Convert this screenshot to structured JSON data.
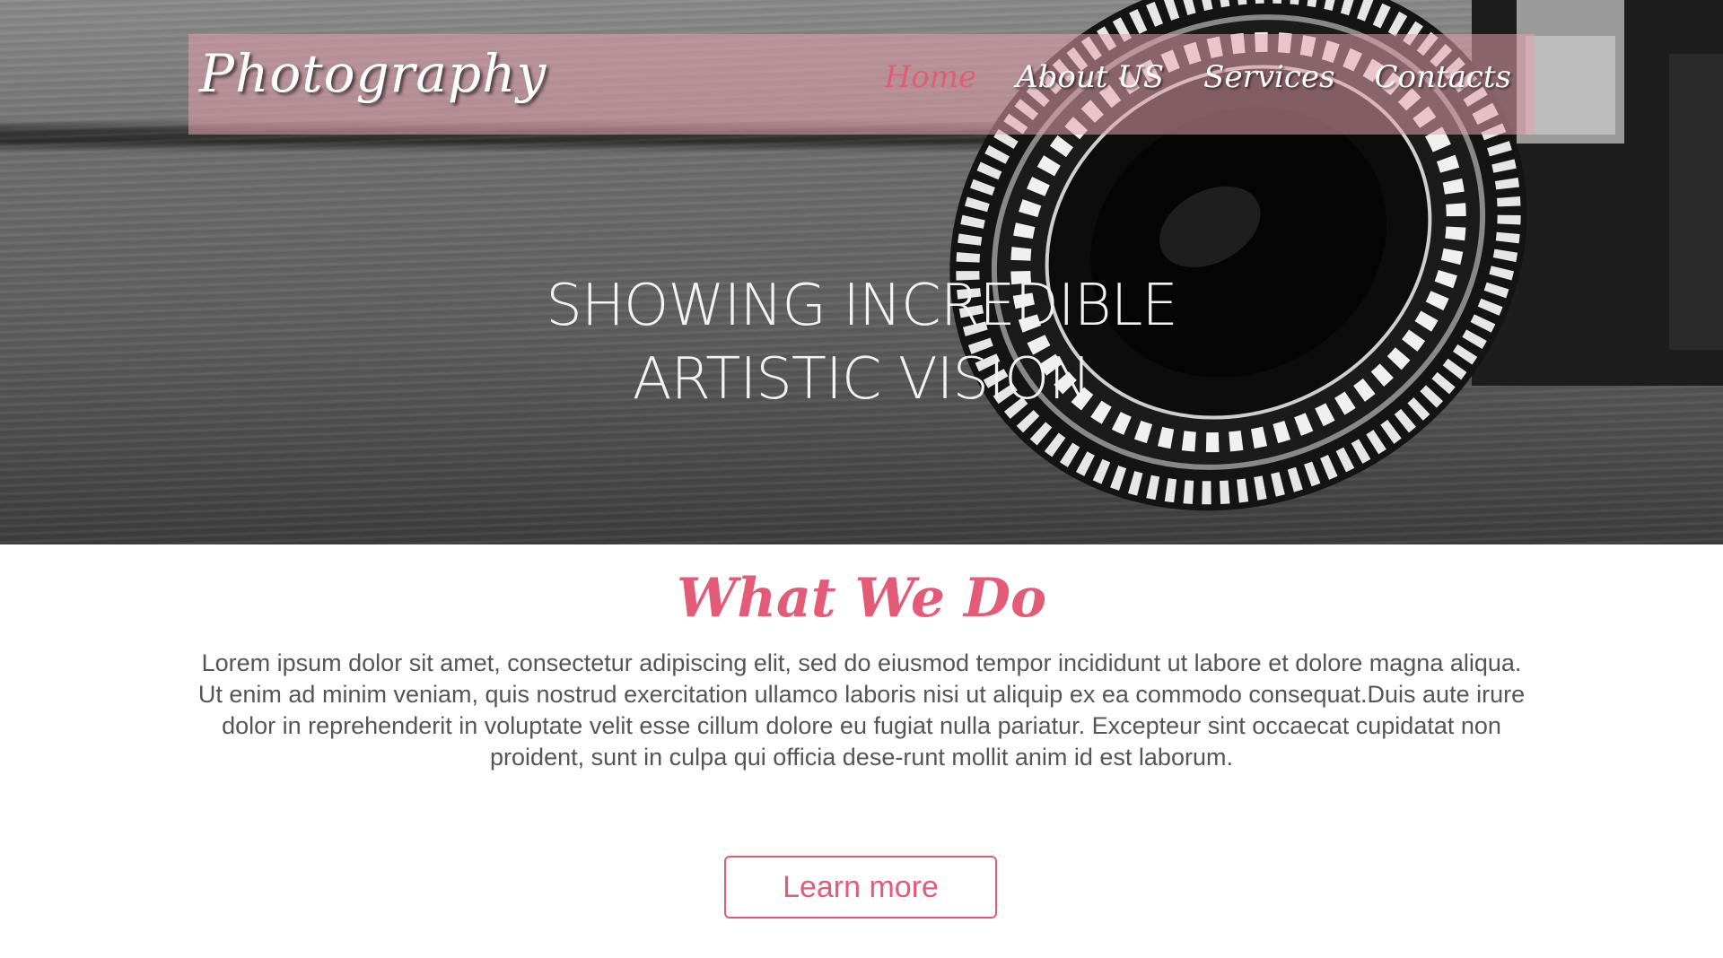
{
  "brand": {
    "logo_text": "Photography"
  },
  "nav": {
    "items": [
      {
        "label": "Home",
        "active": true
      },
      {
        "label": "About US",
        "active": false
      },
      {
        "label": "Services",
        "active": false
      },
      {
        "label": "Contacts",
        "active": false
      }
    ]
  },
  "hero": {
    "headline_line1": "SHOWING INCREDIBLE",
    "headline_line2": "ARTISTIC VISION"
  },
  "section": {
    "title": "What We Do",
    "body": "Lorem ipsum dolor sit amet, consectetur adipiscing elit, sed do eiusmod tempor incididunt ut labore et dolore magna aliqua. Ut enim ad minim veniam, quis nostrud exercitation ullamco laboris nisi ut aliquip ex ea commodo consequat.Duis aute irure dolor in reprehenderit in voluptate velit esse cillum dolore eu fugiat nulla pariatur. Excepteur sint occaecat cupidatat non proident, sunt in culpa qui officia dese-runt mollit anim id est laborum.",
    "cta_label": "Learn more"
  },
  "colors": {
    "accent": "#e45b78",
    "nav_overlay": "#e4a0ac",
    "body_text": "#555555"
  }
}
